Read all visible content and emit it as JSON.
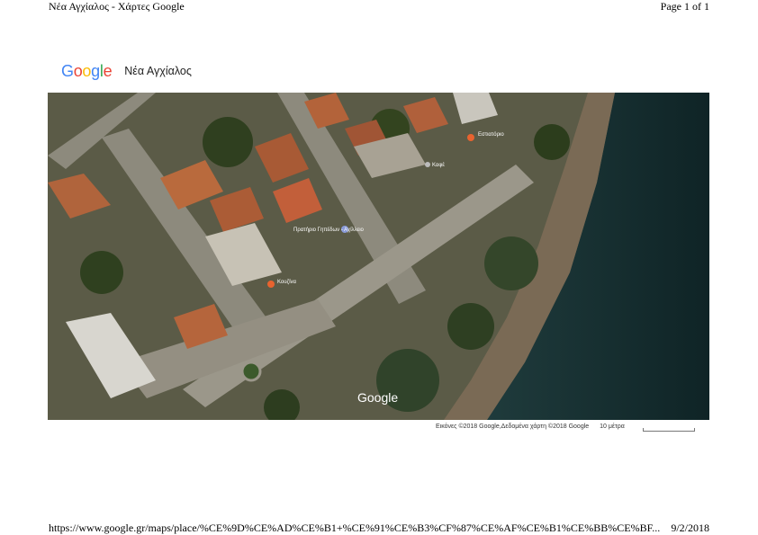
{
  "print_header": {
    "title": "Νέα Αγχίαλος - Χάρτες Google",
    "page": "Page 1 of 1"
  },
  "brand": {
    "logo_text": "Google",
    "colors": [
      "#4285F4",
      "#EA4335",
      "#FBBC05",
      "#4285F4",
      "#34A853",
      "#EA4335"
    ]
  },
  "place": {
    "name": "Νέα Αγχίαλος"
  },
  "map": {
    "watermark": "Google",
    "poi_labels": [
      "Πρατήριο Γηπέδων - Αχίλλειο",
      "Εστιατόριο",
      "Καφέ",
      "Κουζίνα"
    ],
    "attribution": "Εικόνες ©2018 Google,Δεδομένα χάρτη ©2018 Google",
    "scale_label": "10 μέτρα"
  },
  "print_footer": {
    "url": "https://www.google.gr/maps/place/%CE%9D%CE%AD%CE%B1+%CE%91%CE%B3%CF%87%CE%AF%CE%B1%CE%BB%CE%BF...",
    "date": "9/2/2018"
  }
}
